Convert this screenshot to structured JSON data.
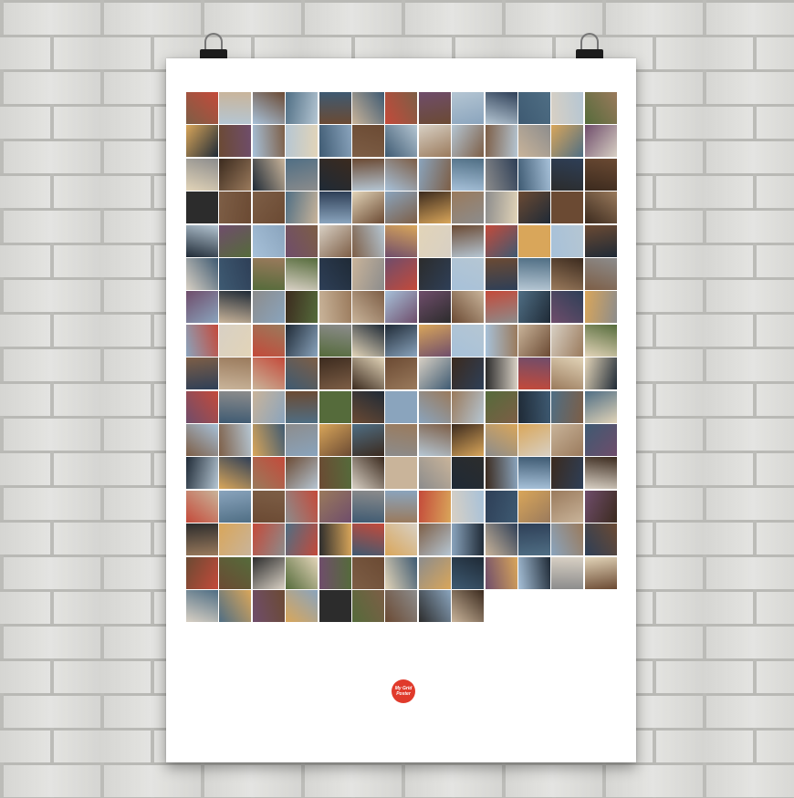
{
  "scene": {
    "subject": "photo-collage-poster-on-brick-wall",
    "wall_color": "#e2e2df",
    "poster_color": "#ffffff",
    "logo_color": "#e03a2b",
    "logo_text": "My Grid Poster"
  },
  "collage": {
    "columns": 13,
    "full_rows": 15,
    "last_row_tiles": 9,
    "palette": [
      "#3b2a1e",
      "#6b4a33",
      "#8aa4bd",
      "#2e3f57",
      "#c9b49a",
      "#4f6e84",
      "#9a7a5c",
      "#1f2a36",
      "#b5c6d3",
      "#7d5e46",
      "#556b3b",
      "#c44a3a",
      "#e2d4b8",
      "#3e5a72",
      "#8c8c8c",
      "#d9a65a",
      "#2c2c2c",
      "#a7c1d9",
      "#6f4d6b",
      "#d8d0c4"
    ]
  },
  "clips": [
    "left-binder-clip",
    "right-binder-clip"
  ]
}
